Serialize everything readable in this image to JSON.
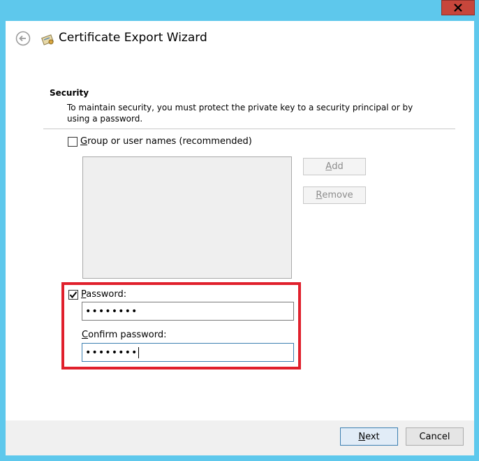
{
  "window": {
    "title": "Certificate Export Wizard",
    "close_icon": "close-icon",
    "back_icon": "back-arrow-icon",
    "app_icon": "certificate-icon"
  },
  "security": {
    "heading": "Security",
    "description": "To maintain security, you must protect the private key to a security principal or by using a password."
  },
  "group_option": {
    "label_access": "G",
    "label_rest": "roup or user names (recommended)",
    "checked": false
  },
  "buttons": {
    "add_access": "A",
    "add_rest": "dd",
    "remove_access": "R",
    "remove_rest": "emove",
    "next_access": "N",
    "next_rest": "ext",
    "cancel": "Cancel"
  },
  "password": {
    "checked": true,
    "label_access": "P",
    "label_rest": "assword:",
    "value": "••••••••",
    "confirm_label_access": "C",
    "confirm_label_rest": "onfirm password:",
    "confirm_value": "••••••••"
  },
  "colors": {
    "window_frame": "#5ec8ec",
    "highlight": "#e0202c"
  }
}
